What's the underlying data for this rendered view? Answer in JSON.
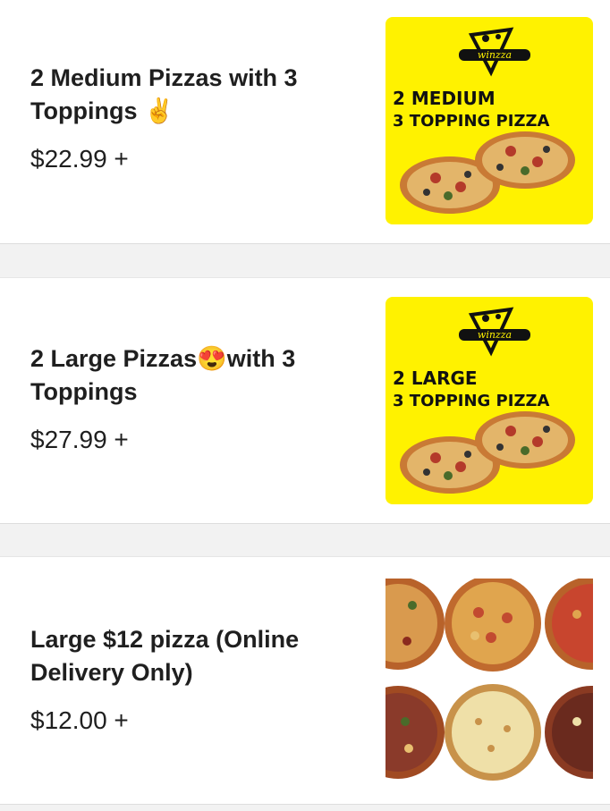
{
  "items": [
    {
      "title_lines": [
        "2 Medium Pizzas with 3",
        "Toppings ✌️"
      ],
      "price": "$22.99 +",
      "image": {
        "type": "promo",
        "brand": "winzza",
        "line1": "2 MEDIUM",
        "line2": "3 TOPPING PIZZA",
        "background": "#fff200"
      }
    },
    {
      "title_lines": [
        "2 Large Pizzas😍with 3",
        "Toppings"
      ],
      "price": "$27.99 +",
      "image": {
        "type": "promo",
        "brand": "winzza",
        "line1": "2 LARGE",
        "line2": "3 TOPPING PIZZA",
        "background": "#fff200"
      }
    },
    {
      "title_lines": [
        "Large $12 pizza (Online",
        "Delivery Only)"
      ],
      "price": "$12.00 +",
      "image": {
        "type": "photo",
        "description_icon": "pizza-grid-icon"
      }
    }
  ]
}
